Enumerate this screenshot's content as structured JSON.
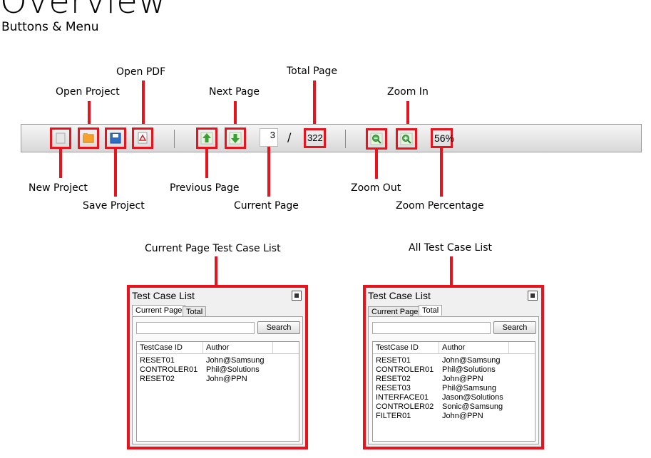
{
  "heading": {
    "title": "Overview",
    "subtitle": "Buttons & Menu"
  },
  "callouts": {
    "open_pdf": "Open PDF",
    "open_project": "Open Project",
    "next_page": "Next Page",
    "total_page": "Total Page",
    "zoom_in": "Zoom In",
    "new_project": "New Project",
    "save_project": "Save Project",
    "previous_page": "Previous Page",
    "current_page": "Current Page",
    "zoom_out": "Zoom Out",
    "zoom_percentage": "Zoom Percentage",
    "current_page_list": "Current Page Test Case List",
    "all_list": "All Test Case List"
  },
  "toolbar": {
    "current_page": "3",
    "separator": "/",
    "total_pages": "322",
    "zoom": "56%"
  },
  "panel_current": {
    "title": "Test Case List",
    "tabs": [
      "Current Page",
      "Total"
    ],
    "active_tab": "Current Page",
    "search_value": "",
    "search_label": "Search",
    "columns": [
      "TestCase ID",
      "Author"
    ],
    "rows": [
      [
        "RESET01",
        "John@Samsung"
      ],
      [
        "CONTROLER01",
        "Phil@Solutions"
      ],
      [
        "RESET02",
        "John@PPN"
      ]
    ]
  },
  "panel_all": {
    "title": "Test Case List",
    "tabs": [
      "Current Page",
      "Total"
    ],
    "active_tab": "Total",
    "search_value": "",
    "search_label": "Search",
    "columns": [
      "TestCase ID",
      "Author"
    ],
    "rows": [
      [
        "RESET01",
        "John@Samsung"
      ],
      [
        "CONTROLER01",
        "Phil@Solutions"
      ],
      [
        "RESET02",
        "John@PPN"
      ],
      [
        "RESET03",
        "Phil@Samsung"
      ],
      [
        "INTERFACE01",
        "Jason@Solutions"
      ],
      [
        "CONTROLER02",
        "Sonic@Samsung"
      ],
      [
        "FILTER01",
        "John@PPN"
      ]
    ]
  },
  "colors": {
    "annotation": "#e8141d",
    "toolbar_border": "#9a9a9a"
  }
}
